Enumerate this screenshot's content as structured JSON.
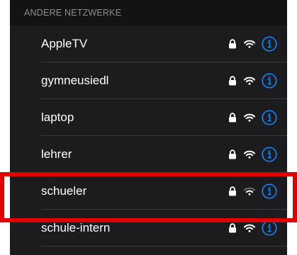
{
  "section_header": "ANDERE NETZWERKE",
  "networks": [
    {
      "name": "AppleTV",
      "secured": true,
      "signal": "strong",
      "info_icon": "info-icon"
    },
    {
      "name": "gymneusiedl",
      "secured": true,
      "signal": "strong",
      "info_icon": "info-icon"
    },
    {
      "name": "laptop",
      "secured": true,
      "signal": "strong",
      "info_icon": "info-icon"
    },
    {
      "name": "lehrer",
      "secured": true,
      "signal": "strong",
      "info_icon": "info-icon"
    },
    {
      "name": "schueler",
      "secured": true,
      "signal": "medium",
      "info_icon": "info-icon",
      "highlighted": true
    },
    {
      "name": "schule-intern",
      "secured": true,
      "signal": "strong",
      "info_icon": "info-icon"
    }
  ],
  "colors": {
    "background": "#1c1c1e",
    "header_background": "#131314",
    "header_text": "#8e8e93",
    "text": "#ffffff",
    "accent": "#0a84ff",
    "separator": "#3a3a3c",
    "highlight": "#e00000"
  }
}
